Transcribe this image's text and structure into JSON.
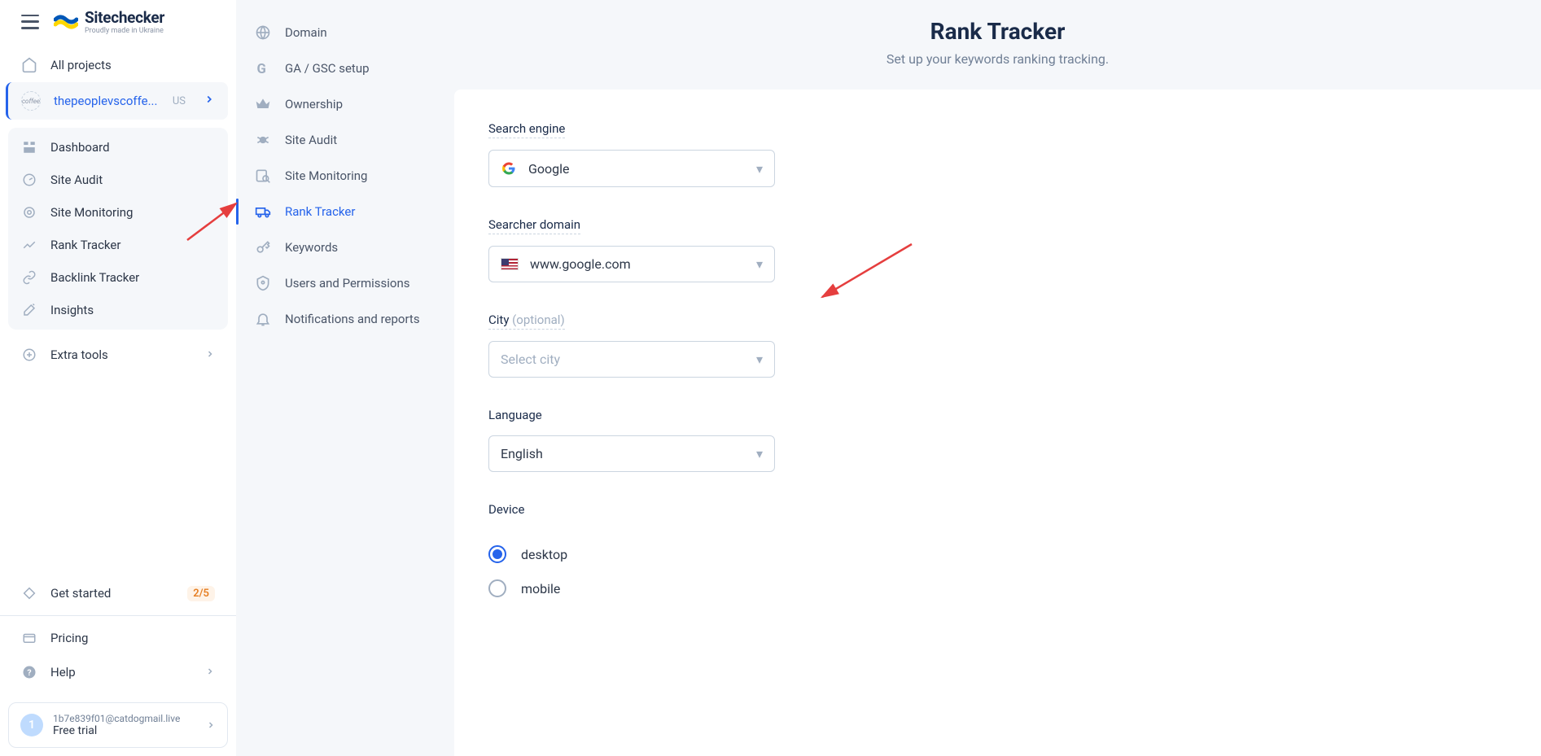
{
  "logo": {
    "title": "Sitechecker",
    "sub": "Proudly made in Ukraine"
  },
  "sidebar": {
    "all_projects": "All projects",
    "project": {
      "name": "thepeoplevscoffe...",
      "country": "US"
    },
    "items": [
      {
        "label": "Dashboard"
      },
      {
        "label": "Site Audit"
      },
      {
        "label": "Site Monitoring"
      },
      {
        "label": "Rank Tracker"
      },
      {
        "label": "Backlink Tracker"
      },
      {
        "label": "Insights"
      }
    ],
    "extra_tools": "Extra tools",
    "get_started": {
      "label": "Get started",
      "badge": "2/5"
    },
    "pricing": "Pricing",
    "help": "Help",
    "account": {
      "initial": "1",
      "email": "1b7e839f01@catdogmail.live",
      "plan": "Free trial"
    }
  },
  "midnav": [
    {
      "label": "Domain"
    },
    {
      "label": "GA / GSC setup"
    },
    {
      "label": "Ownership"
    },
    {
      "label": "Site Audit"
    },
    {
      "label": "Site Monitoring"
    },
    {
      "label": "Rank Tracker"
    },
    {
      "label": "Keywords"
    },
    {
      "label": "Users and Permissions"
    },
    {
      "label": "Notifications and reports"
    }
  ],
  "main": {
    "title": "Rank Tracker",
    "subtitle": "Set up your keywords ranking tracking.",
    "search_engine": {
      "label": "Search engine",
      "value": "Google"
    },
    "searcher_domain": {
      "label": "Searcher domain",
      "value": "www.google.com"
    },
    "city": {
      "label": "City ",
      "optional": "(optional)",
      "placeholder": "Select city"
    },
    "language": {
      "label": "Language",
      "value": "English"
    },
    "device": {
      "label": "Device",
      "desktop": "desktop",
      "mobile": "mobile"
    }
  }
}
